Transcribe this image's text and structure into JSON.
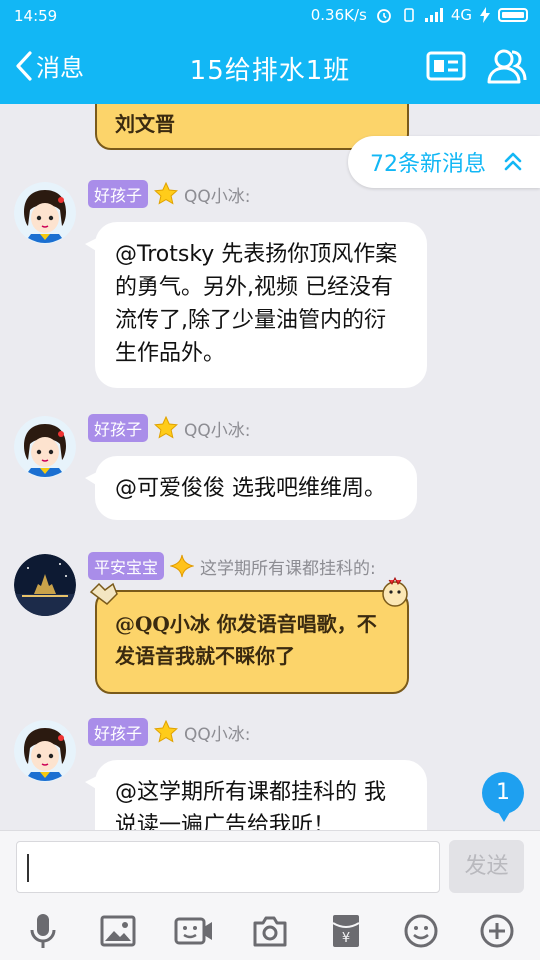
{
  "status_bar": {
    "time": "14:59",
    "net_speed": "0.36K/s",
    "network": "4G"
  },
  "header": {
    "back_label": "消息",
    "title": "15给排水1班"
  },
  "new_messages_label": "72条新消息",
  "top_partial_bubble_text": "刘文晋",
  "messages": [
    {
      "badge": "好孩子",
      "sender": "QQ小冰:",
      "text": "@Trotsky 先表扬你顶风作案的勇气。另外,视频 已经没有流传了,除了少量油管内的衍生作品外。"
    },
    {
      "badge": "好孩子",
      "sender": "QQ小冰:",
      "text": "@可爱俊俊 选我吧维维周。"
    },
    {
      "badge": "平安宝宝",
      "sender": "这学期所有课都挂科的:",
      "text": "@QQ小冰 你发语音唱歌，不发语音我就不睬你了"
    },
    {
      "badge": "好孩子",
      "sender": "QQ小冰:",
      "text": "@这学期所有课都挂科的 我说读一遍广告给我听！"
    }
  ],
  "unread_count": "1",
  "input": {
    "placeholder": "",
    "value": ""
  },
  "send_label": "发送",
  "toolbar_icons": [
    "mic-icon",
    "image-icon",
    "video-call-icon",
    "camera-icon",
    "red-packet-icon",
    "emoji-icon",
    "plus-icon"
  ],
  "colors": {
    "header_bg": "#12b7f5",
    "chat_bg": "#ebebf0",
    "badge_purple": "#a98de9",
    "yellow_bubble": "#fcd46a",
    "unread_blue": "#1ea0f0"
  }
}
